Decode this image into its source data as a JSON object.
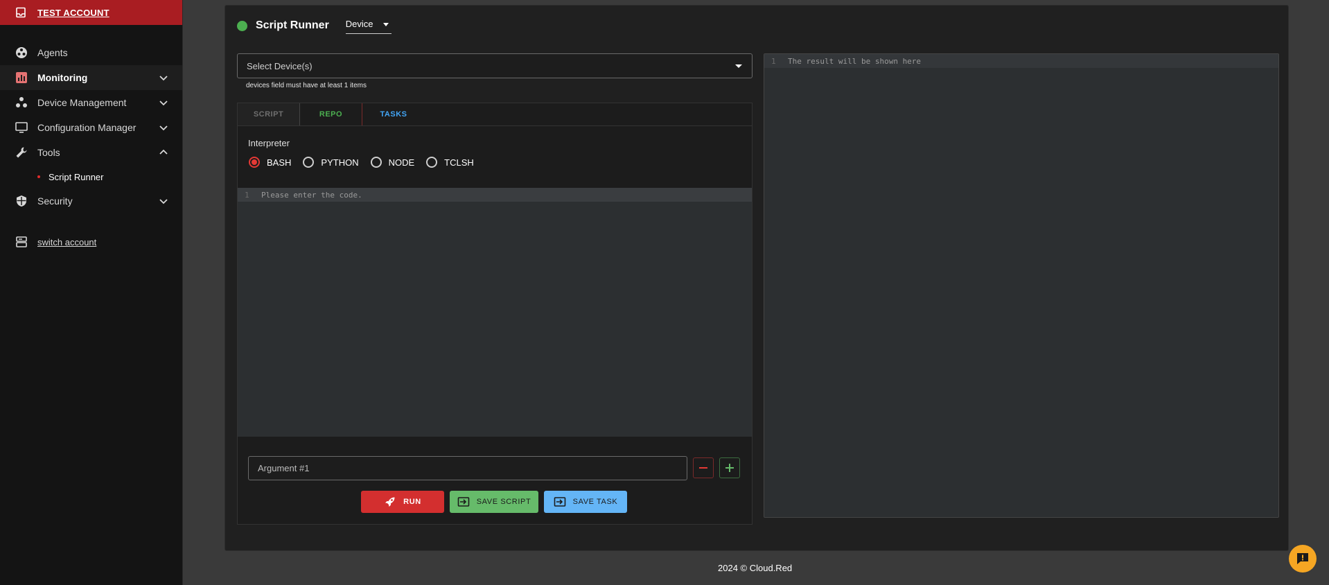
{
  "account": {
    "label": "TEST ACCOUNT"
  },
  "sidebar": {
    "items": [
      {
        "label": "Agents",
        "icon": "agents-icon"
      },
      {
        "label": "Monitoring",
        "icon": "monitoring-icon"
      },
      {
        "label": "Device Management",
        "icon": "device-management-icon"
      },
      {
        "label": "Configuration Manager",
        "icon": "monitor-icon"
      },
      {
        "label": "Tools",
        "icon": "wrench-icon"
      },
      {
        "label": "Security",
        "icon": "shield-icon"
      }
    ],
    "sub_items": [
      {
        "label": "Script Runner"
      }
    ],
    "switch_account": "switch account"
  },
  "header": {
    "title": "Script Runner",
    "mode": "Device"
  },
  "device_select": {
    "placeholder": "Select Device(s)",
    "error": "devices field must have at least 1 items"
  },
  "tabs": [
    {
      "label": "SCRIPT"
    },
    {
      "label": "REPO"
    },
    {
      "label": "TASKS"
    }
  ],
  "interpreter": {
    "label": "Interpreter",
    "options": [
      {
        "label": "BASH"
      },
      {
        "label": "PYTHON"
      },
      {
        "label": "NODE"
      },
      {
        "label": "TCLSH"
      }
    ],
    "selected": "BASH"
  },
  "editor": {
    "line_number": "1",
    "placeholder": "Please enter the code."
  },
  "argument": {
    "placeholder": "Argument #1"
  },
  "buttons": {
    "run": "RUN",
    "save_script": "SAVE SCRIPT",
    "save_task": "SAVE TASK"
  },
  "result": {
    "line_number": "1",
    "placeholder": "The result will be shown here"
  },
  "footer": {
    "text": "2024  © Cloud.Red"
  },
  "colors": {
    "brand_red": "#a91d22",
    "success": "#4caf50",
    "info": "#64b5f6",
    "chat": "#f5a623"
  }
}
